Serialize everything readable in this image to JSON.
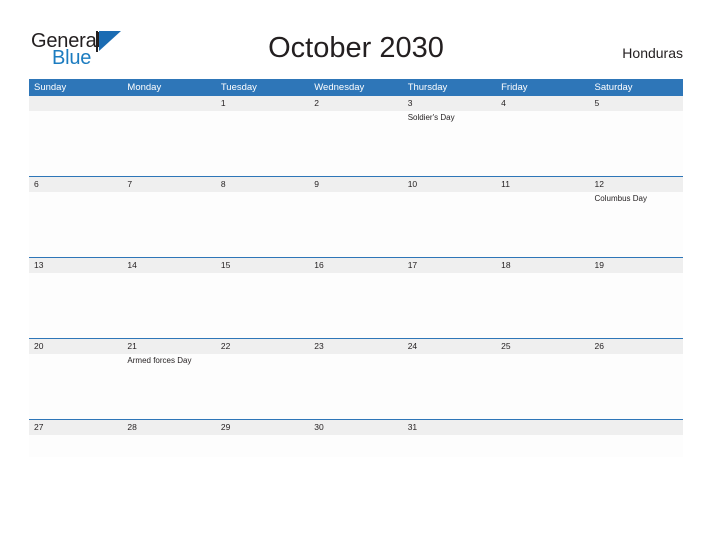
{
  "brand": {
    "name_part1": "General",
    "name_part2": "Blue",
    "flag_icon": "flag-triangle-icon"
  },
  "header": {
    "title": "October 2030",
    "country": "Honduras"
  },
  "calendar": {
    "weekday_headers": [
      "Sunday",
      "Monday",
      "Tuesday",
      "Wednesday",
      "Thursday",
      "Friday",
      "Saturday"
    ],
    "accent_color": "#2e76b8",
    "date_band_color": "#efefef",
    "text_color": "#231f20",
    "weeks": [
      {
        "days": [
          {
            "num": "",
            "events": []
          },
          {
            "num": "",
            "events": []
          },
          {
            "num": "1",
            "events": []
          },
          {
            "num": "2",
            "events": []
          },
          {
            "num": "3",
            "events": [
              "Soldier's Day"
            ]
          },
          {
            "num": "4",
            "events": []
          },
          {
            "num": "5",
            "events": []
          }
        ]
      },
      {
        "days": [
          {
            "num": "6",
            "events": []
          },
          {
            "num": "7",
            "events": []
          },
          {
            "num": "8",
            "events": []
          },
          {
            "num": "9",
            "events": []
          },
          {
            "num": "10",
            "events": []
          },
          {
            "num": "11",
            "events": []
          },
          {
            "num": "12",
            "events": [
              "Columbus Day"
            ]
          }
        ]
      },
      {
        "days": [
          {
            "num": "13",
            "events": []
          },
          {
            "num": "14",
            "events": []
          },
          {
            "num": "15",
            "events": []
          },
          {
            "num": "16",
            "events": []
          },
          {
            "num": "17",
            "events": []
          },
          {
            "num": "18",
            "events": []
          },
          {
            "num": "19",
            "events": []
          }
        ]
      },
      {
        "days": [
          {
            "num": "20",
            "events": []
          },
          {
            "num": "21",
            "events": [
              "Armed forces Day"
            ]
          },
          {
            "num": "22",
            "events": []
          },
          {
            "num": "23",
            "events": []
          },
          {
            "num": "24",
            "events": []
          },
          {
            "num": "25",
            "events": []
          },
          {
            "num": "26",
            "events": []
          }
        ]
      },
      {
        "days": [
          {
            "num": "27",
            "events": []
          },
          {
            "num": "28",
            "events": []
          },
          {
            "num": "29",
            "events": []
          },
          {
            "num": "30",
            "events": []
          },
          {
            "num": "31",
            "events": []
          },
          {
            "num": "",
            "events": []
          },
          {
            "num": "",
            "events": []
          }
        ]
      }
    ]
  }
}
